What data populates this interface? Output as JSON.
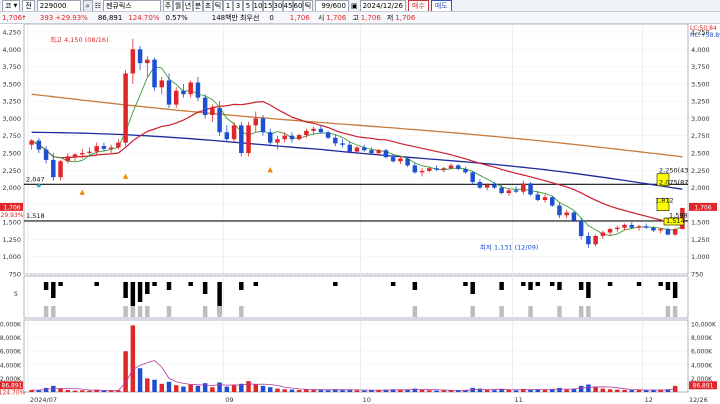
{
  "toolbar": {
    "market_code": "코",
    "market_type": "전",
    "stock_code": "229000",
    "stock_name": "젠큐릭스",
    "timeframes": [
      "주",
      "월",
      "년",
      "분",
      "초",
      "틱",
      "1",
      "3",
      "5",
      "10",
      "15",
      "30",
      "45",
      "60",
      "틱"
    ],
    "count": "99/600",
    "date": "2024/12/26",
    "buy_label": "매수",
    "sell_label": "매도"
  },
  "quote": {
    "price": "1,706",
    "change": "393",
    "change_rate": "+29.93%",
    "volume": "86,891",
    "volume_ratio": "124.70%",
    "turnover": "0.57%",
    "amount": "148백만",
    "priority_label": "최우선",
    "priority_value": "0",
    "last": "1,706",
    "open_label": "시",
    "open": "1,706",
    "high_label": "고",
    "high": "1,706",
    "low_label": "저",
    "low": "1,706"
  },
  "colors": {
    "up": "#e0262a",
    "down": "#1d4fd1",
    "ma5": "#3a9a3a",
    "ma20": "#cc1e2c",
    "ma60": "#1c2a9c",
    "ma120": "#c87a3a",
    "gray": "#bdbdbd",
    "yellow": "#ffff00"
  },
  "icons": [
    "dropdown-icon",
    "search-icon",
    "settings-icon",
    "calendar-icon",
    "up-arrow-icon"
  ],
  "price_axis": {
    "ticks": [
      "4,250",
      "4,000",
      "3,750",
      "3,500",
      "3,250",
      "3,000",
      "2,750",
      "2,500",
      "2,250",
      "2,000",
      "1,750",
      "1,500",
      "1,250",
      "1,000",
      "750"
    ],
    "values": [
      4250,
      4000,
      3750,
      3500,
      3250,
      3000,
      2750,
      2500,
      2250,
      2000,
      1750,
      1500,
      1250,
      1000,
      750
    ],
    "right_top": "LC:50.84",
    "right_top2": "HC:+58.89"
  },
  "volume_axis": {
    "ticks": [
      "10,000K",
      "8,000K",
      "6,000K",
      "4,000K",
      "2,000K"
    ],
    "values": [
      10000,
      8000,
      6000,
      4000,
      2000
    ],
    "current": "86,891",
    "current_rate": "124.70%"
  },
  "indicator_axis": {
    "label": "5"
  },
  "annotations": {
    "high": "최고 4,150 (08/16)",
    "low": "최저 1,131 (12/09)",
    "line1": "2,047",
    "line2": "1,518",
    "r1": "2,250(43",
    "r2": "2,075(87",
    "r3": "1,812",
    "r4": "1,598",
    "r5": "1,514",
    "left_price": "1,706",
    "left_rate": "29.93%",
    "right_price": "1,706"
  },
  "chart_data": {
    "type": "candlestick",
    "x_labels": [
      "2024/07",
      "09",
      "10",
      "11",
      "12",
      "12/26"
    ],
    "ylim": [
      750,
      4250
    ],
    "hlines": [
      2047,
      1518
    ],
    "candles": [
      [
        2620,
        2700,
        2550,
        2680
      ],
      [
        2680,
        2720,
        2500,
        2550
      ],
      [
        2550,
        2600,
        2350,
        2400
      ],
      [
        2400,
        2500,
        2100,
        2150
      ],
      [
        2150,
        2400,
        2100,
        2380
      ],
      [
        2380,
        2500,
        2350,
        2450
      ],
      [
        2450,
        2500,
        2380,
        2480
      ],
      [
        2480,
        2560,
        2420,
        2500
      ],
      [
        2500,
        2580,
        2450,
        2520
      ],
      [
        2520,
        2650,
        2480,
        2600
      ],
      [
        2600,
        2650,
        2520,
        2560
      ],
      [
        2560,
        2620,
        2500,
        2580
      ],
      [
        2580,
        2700,
        2550,
        2650
      ],
      [
        2650,
        3700,
        2600,
        3650
      ],
      [
        3650,
        4150,
        3500,
        4000
      ],
      [
        4000,
        4050,
        3700,
        3800
      ],
      [
        3800,
        3900,
        3600,
        3850
      ],
      [
        3850,
        3880,
        3400,
        3450
      ],
      [
        3450,
        3600,
        3350,
        3550
      ],
      [
        3550,
        3650,
        3150,
        3200
      ],
      [
        3200,
        3450,
        3150,
        3400
      ],
      [
        3400,
        3500,
        3300,
        3350
      ],
      [
        3350,
        3550,
        3300,
        3520
      ],
      [
        3520,
        3600,
        3250,
        3300
      ],
      [
        3300,
        3350,
        3000,
        3050
      ],
      [
        3050,
        3200,
        2950,
        3150
      ],
      [
        3150,
        3250,
        2750,
        2800
      ],
      [
        2800,
        2900,
        2650,
        2700
      ],
      [
        2700,
        2950,
        2650,
        2900
      ],
      [
        2900,
        2950,
        2450,
        2500
      ],
      [
        2500,
        2950,
        2450,
        2900
      ],
      [
        2900,
        3100,
        2800,
        3000
      ],
      [
        3000,
        3050,
        2750,
        2800
      ],
      [
        2800,
        2850,
        2600,
        2650
      ],
      [
        2650,
        2750,
        2550,
        2700
      ],
      [
        2700,
        2800,
        2650,
        2750
      ],
      [
        2750,
        2800,
        2650,
        2700
      ],
      [
        2700,
        2780,
        2680,
        2760
      ],
      [
        2760,
        2850,
        2720,
        2820
      ],
      [
        2820,
        2880,
        2760,
        2850
      ],
      [
        2850,
        2900,
        2780,
        2800
      ],
      [
        2800,
        2820,
        2700,
        2720
      ],
      [
        2720,
        2760,
        2600,
        2640
      ],
      [
        2640,
        2700,
        2580,
        2620
      ],
      [
        2620,
        2660,
        2500,
        2520
      ],
      [
        2520,
        2600,
        2480,
        2580
      ],
      [
        2580,
        2620,
        2520,
        2540
      ],
      [
        2540,
        2580,
        2480,
        2500
      ],
      [
        2500,
        2560,
        2460,
        2540
      ],
      [
        2540,
        2560,
        2420,
        2440
      ],
      [
        2440,
        2480,
        2360,
        2380
      ],
      [
        2380,
        2450,
        2340,
        2420
      ],
      [
        2420,
        2440,
        2300,
        2320
      ],
      [
        2320,
        2360,
        2200,
        2220
      ],
      [
        2220,
        2280,
        2160,
        2240
      ],
      [
        2240,
        2300,
        2220,
        2280
      ],
      [
        2280,
        2320,
        2240,
        2260
      ],
      [
        2260,
        2300,
        2220,
        2280
      ],
      [
        2280,
        2350,
        2260,
        2320
      ],
      [
        2320,
        2340,
        2250,
        2270
      ],
      [
        2270,
        2300,
        2200,
        2220
      ],
      [
        2220,
        2240,
        2050,
        2080
      ],
      [
        2080,
        2120,
        1980,
        2000
      ],
      [
        2000,
        2060,
        1960,
        2040
      ],
      [
        2040,
        2080,
        1980,
        2000
      ],
      [
        2000,
        2050,
        1900,
        1920
      ],
      [
        1920,
        1980,
        1880,
        1960
      ],
      [
        1960,
        2020,
        1920,
        1940
      ],
      [
        1940,
        2100,
        1900,
        2060
      ],
      [
        2060,
        2080,
        1880,
        1900
      ],
      [
        1900,
        1950,
        1800,
        1820
      ],
      [
        1820,
        1900,
        1780,
        1860
      ],
      [
        1860,
        1880,
        1720,
        1740
      ],
      [
        1740,
        1780,
        1560,
        1600
      ],
      [
        1600,
        1680,
        1560,
        1640
      ],
      [
        1640,
        1660,
        1500,
        1520
      ],
      [
        1520,
        1560,
        1250,
        1300
      ],
      [
        1300,
        1350,
        1131,
        1180
      ],
      [
        1180,
        1320,
        1150,
        1300
      ],
      [
        1300,
        1380,
        1260,
        1350
      ],
      [
        1350,
        1420,
        1300,
        1400
      ],
      [
        1400,
        1450,
        1360,
        1420
      ],
      [
        1420,
        1480,
        1380,
        1460
      ],
      [
        1460,
        1500,
        1400,
        1420
      ],
      [
        1420,
        1460,
        1380,
        1440
      ],
      [
        1440,
        1480,
        1400,
        1420
      ],
      [
        1420,
        1440,
        1360,
        1380
      ],
      [
        1380,
        1420,
        1340,
        1400
      ],
      [
        1400,
        1420,
        1310,
        1320
      ],
      [
        1320,
        1420,
        1300,
        1400
      ],
      [
        1400,
        1706,
        1400,
        1706
      ]
    ],
    "volume": [
      300,
      250,
      600,
      900,
      500,
      300,
      200,
      250,
      200,
      350,
      200,
      180,
      250,
      6000,
      9800,
      3500,
      2000,
      1800,
      1200,
      1500,
      1000,
      800,
      1100,
      900,
      1300,
      700,
      1400,
      800,
      1000,
      1200,
      1600,
      1100,
      900,
      700,
      500,
      400,
      350,
      300,
      400,
      350,
      300,
      250,
      400,
      300,
      350,
      250,
      200,
      300,
      250,
      350,
      400,
      300,
      350,
      500,
      300,
      250,
      200,
      220,
      260,
      240,
      300,
      600,
      500,
      300,
      280,
      400,
      300,
      250,
      450,
      350,
      400,
      300,
      450,
      600,
      350,
      500,
      900,
      1100,
      800,
      500,
      400,
      350,
      300,
      280,
      300,
      260,
      300,
      350,
      400,
      900
    ],
    "indicator": [
      0,
      0,
      -2,
      -4,
      -1,
      0,
      0,
      0,
      0,
      -1,
      0,
      0,
      0,
      -4,
      -6,
      -5,
      -3,
      -1,
      0,
      -2,
      0,
      0,
      -1,
      0,
      -3,
      0,
      -8,
      0,
      0,
      -2,
      0,
      -1,
      0,
      0,
      0,
      0,
      0,
      0,
      0,
      0,
      0,
      0,
      -1,
      0,
      0,
      0,
      0,
      0,
      0,
      0,
      -1,
      0,
      0,
      -2,
      0,
      0,
      0,
      0,
      0,
      0,
      -1,
      -3,
      0,
      0,
      0,
      -2,
      0,
      0,
      -1,
      -2,
      -1,
      0,
      -1,
      -2,
      0,
      0,
      -2,
      -4,
      0,
      0,
      -1,
      0,
      0,
      0,
      -1,
      0,
      0,
      -1,
      -2,
      -4
    ]
  }
}
